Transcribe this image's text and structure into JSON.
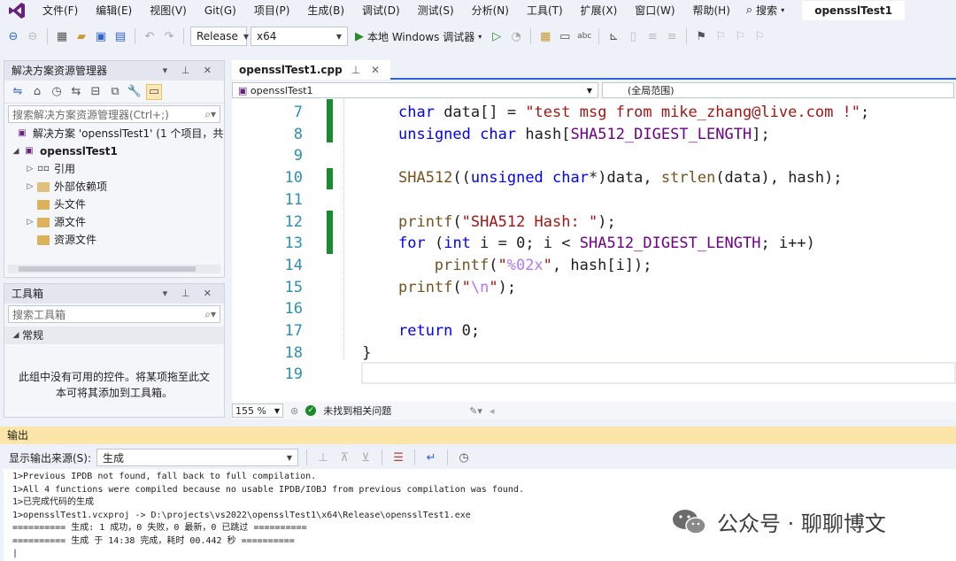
{
  "menubar": {
    "items": [
      "文件(F)",
      "编辑(E)",
      "视图(V)",
      "Git(G)",
      "项目(P)",
      "生成(B)",
      "调试(D)",
      "测试(S)",
      "分析(N)",
      "工具(T)",
      "扩展(X)",
      "窗口(W)",
      "帮助(H)"
    ],
    "search": "搜索",
    "solution_name": "opensslTest1"
  },
  "toolbar": {
    "configuration": "Release",
    "platform": "x64",
    "run_label": "本地 Windows 调试器"
  },
  "solution_explorer": {
    "title": "解决方案资源管理器",
    "search_placeholder": "搜索解决方案资源管理器(Ctrl+;)",
    "solution_row": "解决方案 'opensslTest1' (1 个项目，共",
    "project": "opensslTest1",
    "items": [
      {
        "label": "引用",
        "expandable": true
      },
      {
        "label": "外部依赖项",
        "expandable": true
      },
      {
        "label": "头文件",
        "expandable": false
      },
      {
        "label": "源文件",
        "expandable": true
      },
      {
        "label": "资源文件",
        "expandable": false
      }
    ]
  },
  "toolbox": {
    "title": "工具箱",
    "search_placeholder": "搜索工具箱",
    "group": "常规",
    "empty_text_1": "此组中没有可用的控件。将某项拖至此文",
    "empty_text_2": "本可将其添加到工具箱。"
  },
  "editor": {
    "tab_label": "opensslTest1.cpp",
    "nav_scope": "opensslTest1",
    "nav_member": "(全局范围)",
    "line_numbers": [
      "7",
      "8",
      "9",
      "10",
      "11",
      "12",
      "13",
      "14",
      "15",
      "16",
      "17",
      "18",
      "19"
    ],
    "code": {
      "l7": [
        "char",
        " data[] = ",
        "\"test msg from mike_zhang@live.com !\"",
        ";"
      ],
      "l8": [
        "unsigned",
        " ",
        "char",
        " hash[",
        "SHA512_DIGEST_LENGTH",
        "];"
      ],
      "l10": [
        "SHA512",
        "((",
        "unsigned",
        " ",
        "char",
        "*)data, ",
        "strlen",
        "(data), hash);"
      ],
      "l12": [
        "printf",
        "(",
        "\"SHA512 Hash: \"",
        ");"
      ],
      "l13": [
        "for",
        " (",
        "int",
        " i = 0; i < ",
        "SHA512_DIGEST_LENGTH",
        "; i++)"
      ],
      "l14": [
        "printf",
        "(",
        "\"",
        "%02x",
        "\"",
        ", hash[i]);"
      ],
      "l15": [
        "printf",
        "(",
        "\"",
        "\\n",
        "\"",
        ");"
      ],
      "l17": [
        "return",
        " 0;"
      ],
      "l18": "}"
    },
    "zoom": "155 %",
    "issues": "未找到相关问题"
  },
  "output": {
    "title": "输出",
    "source_label": "显示输出来源(S):",
    "source_value": "生成",
    "lines": [
      "1>Previous IPDB not found, fall back to full compilation.",
      "1>All 4 functions were compiled because no usable IPDB/IOBJ from previous compilation was found.",
      "1>已完成代码的生成",
      "1>opensslTest1.vcxproj -> D:\\projects\\vs2022\\opensslTest1\\x64\\Release\\opensslTest1.exe",
      "========== 生成: 1 成功，0 失败，0 最新，0 已跳过 ==========",
      "========== 生成 于 14:38 完成，耗时 00.442 秒 =========="
    ]
  },
  "watermark": {
    "text": "公众号 · 聊聊博文"
  },
  "colors": {
    "accent": "#2f63d8",
    "vs_purple": "#68217a",
    "changebar": "#1b8b2f",
    "output_title": "#fbe5a8"
  }
}
